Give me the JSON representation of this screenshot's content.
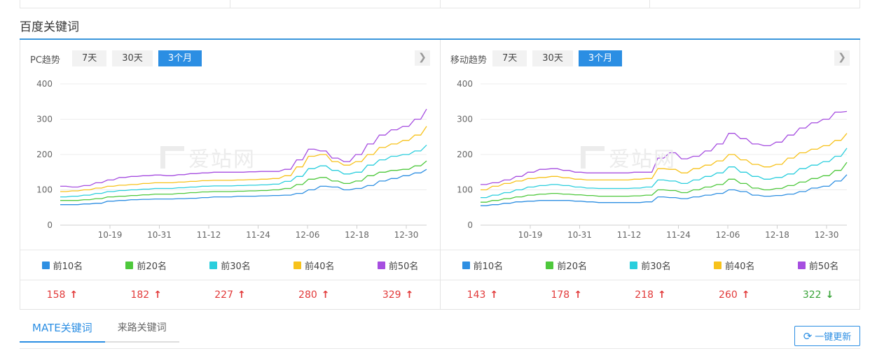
{
  "section_title": "百度关键词",
  "panels": [
    {
      "title": "PC趋势",
      "tabs": [
        "7天",
        "30天",
        "3个月"
      ],
      "active_tab": 2,
      "legend": [
        "前10名",
        "前20名",
        "前30名",
        "前40名",
        "前50名"
      ],
      "values": [
        {
          "value": "158",
          "dir": "up"
        },
        {
          "value": "182",
          "dir": "up"
        },
        {
          "value": "227",
          "dir": "up"
        },
        {
          "value": "280",
          "dir": "up"
        },
        {
          "value": "329",
          "dir": "up"
        }
      ]
    },
    {
      "title": "移动趋势",
      "tabs": [
        "7天",
        "30天",
        "3个月"
      ],
      "active_tab": 2,
      "legend": [
        "前10名",
        "前20名",
        "前30名",
        "前40名",
        "前50名"
      ],
      "values": [
        {
          "value": "143",
          "dir": "up"
        },
        {
          "value": "178",
          "dir": "up"
        },
        {
          "value": "218",
          "dir": "up"
        },
        {
          "value": "260",
          "dir": "up"
        },
        {
          "value": "322",
          "dir": "down"
        }
      ]
    }
  ],
  "watermark": "爱站网",
  "colors": {
    "series": [
      "#2e8fe2",
      "#4ec83c",
      "#2acedd",
      "#f7c21b",
      "#a64ee0"
    ],
    "accent": "#2b8ee3",
    "up": "#e23a3a",
    "down": "#3aa43a"
  },
  "icons": {
    "next": "chevron-right-icon",
    "up": "arrow-up-icon",
    "down": "arrow-down-icon",
    "refresh": "refresh-icon"
  },
  "bottom_tabs": [
    "MATE关键词",
    "来路关键词"
  ],
  "update_button": "一键更新",
  "chart_data": [
    {
      "type": "line",
      "ylim": [
        0,
        400
      ],
      "yticks": [
        0,
        100,
        200,
        300,
        400
      ],
      "xticks": [
        "10-19",
        "10-31",
        "11-12",
        "11-24",
        "12-06",
        "12-18",
        "12-30"
      ],
      "series": [
        {
          "name": "前10名",
          "values": [
            58,
            58,
            60,
            62,
            68,
            70,
            72,
            73,
            74,
            74,
            75,
            76,
            78,
            80,
            80,
            82,
            82,
            83,
            84,
            85,
            90,
            100,
            110,
            108,
            100,
            104,
            112,
            125,
            132,
            140,
            148,
            158
          ]
        },
        {
          "name": "前20名",
          "values": [
            70,
            70,
            72,
            75,
            80,
            82,
            84,
            86,
            88,
            88,
            90,
            92,
            94,
            95,
            95,
            96,
            97,
            98,
            100,
            104,
            115,
            130,
            135,
            125,
            118,
            125,
            140,
            150,
            155,
            158,
            168,
            182
          ]
        },
        {
          "name": "前30名",
          "values": [
            80,
            82,
            85,
            90,
            95,
            98,
            100,
            102,
            104,
            104,
            106,
            108,
            110,
            111,
            111,
            112,
            113,
            114,
            116,
            124,
            138,
            160,
            168,
            155,
            145,
            150,
            170,
            185,
            195,
            200,
            210,
            227
          ]
        },
        {
          "name": "前40名",
          "values": [
            95,
            97,
            100,
            105,
            110,
            113,
            115,
            118,
            120,
            120,
            122,
            124,
            126,
            127,
            127,
            128,
            129,
            130,
            132,
            140,
            165,
            195,
            200,
            180,
            170,
            180,
            200,
            220,
            230,
            240,
            255,
            280
          ]
        },
        {
          "name": "前50名",
          "values": [
            110,
            108,
            112,
            120,
            128,
            135,
            138,
            140,
            142,
            140,
            143,
            146,
            148,
            150,
            150,
            150,
            151,
            152,
            152,
            158,
            185,
            215,
            210,
            190,
            180,
            200,
            230,
            255,
            270,
            280,
            300,
            329
          ]
        }
      ]
    },
    {
      "type": "line",
      "ylim": [
        0,
        400
      ],
      "yticks": [
        0,
        100,
        200,
        300,
        400
      ],
      "xticks": [
        "10-19",
        "10-31",
        "11-12",
        "11-24",
        "12-06",
        "12-18",
        "12-30"
      ],
      "series": [
        {
          "name": "前10名",
          "values": [
            55,
            58,
            62,
            66,
            68,
            70,
            70,
            70,
            68,
            66,
            64,
            64,
            64,
            64,
            66,
            80,
            78,
            75,
            80,
            85,
            90,
            100,
            95,
            85,
            82,
            84,
            88,
            95,
            105,
            110,
            125,
            143
          ]
        },
        {
          "name": "前20名",
          "values": [
            65,
            70,
            75,
            80,
            85,
            88,
            90,
            88,
            86,
            84,
            82,
            82,
            82,
            83,
            85,
            100,
            98,
            92,
            100,
            108,
            115,
            130,
            118,
            105,
            100,
            104,
            112,
            122,
            132,
            140,
            155,
            178
          ]
        },
        {
          "name": "前30名",
          "values": [
            78,
            85,
            92,
            100,
            108,
            112,
            115,
            112,
            108,
            105,
            104,
            104,
            104,
            105,
            108,
            128,
            125,
            118,
            128,
            138,
            148,
            165,
            150,
            138,
            130,
            135,
            145,
            160,
            170,
            180,
            195,
            218
          ]
        },
        {
          "name": "前40名",
          "values": [
            100,
            110,
            118,
            125,
            132,
            135,
            138,
            134,
            130,
            128,
            128,
            128,
            128,
            130,
            132,
            160,
            158,
            148,
            160,
            170,
            182,
            200,
            185,
            172,
            165,
            172,
            190,
            205,
            215,
            225,
            240,
            260
          ]
        },
        {
          "name": "前50名",
          "values": [
            115,
            120,
            128,
            138,
            150,
            158,
            160,
            155,
            150,
            148,
            148,
            148,
            148,
            150,
            150,
            190,
            205,
            188,
            195,
            210,
            230,
            260,
            245,
            230,
            225,
            235,
            255,
            275,
            290,
            300,
            320,
            322
          ]
        }
      ]
    }
  ]
}
